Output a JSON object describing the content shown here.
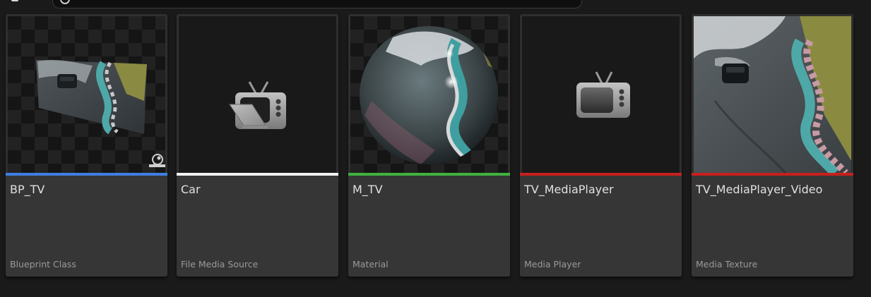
{
  "search": {
    "placeholder": "",
    "icon": "search-icon"
  },
  "assets": [
    {
      "name": "BP_TV",
      "type": "Blueprint Class",
      "type_color": "#3f7fe0",
      "thumbnail": "tv-screen-preview",
      "overlay_icon": "blueprint-actor-icon"
    },
    {
      "name": "Car",
      "type": "File Media Source",
      "type_color": "#f2f2f2",
      "thumbnail": "file-media-source-icon"
    },
    {
      "name": "M_TV",
      "type": "Material",
      "type_color": "#3fb23f",
      "thumbnail": "material-sphere-preview"
    },
    {
      "name": "TV_MediaPlayer",
      "type": "Media Player",
      "type_color": "#c8201e",
      "thumbnail": "media-player-icon"
    },
    {
      "name": "TV_MediaPlayer_Video",
      "type": "Media Texture",
      "type_color": "#c8201e",
      "thumbnail": "video-frame-preview"
    }
  ]
}
